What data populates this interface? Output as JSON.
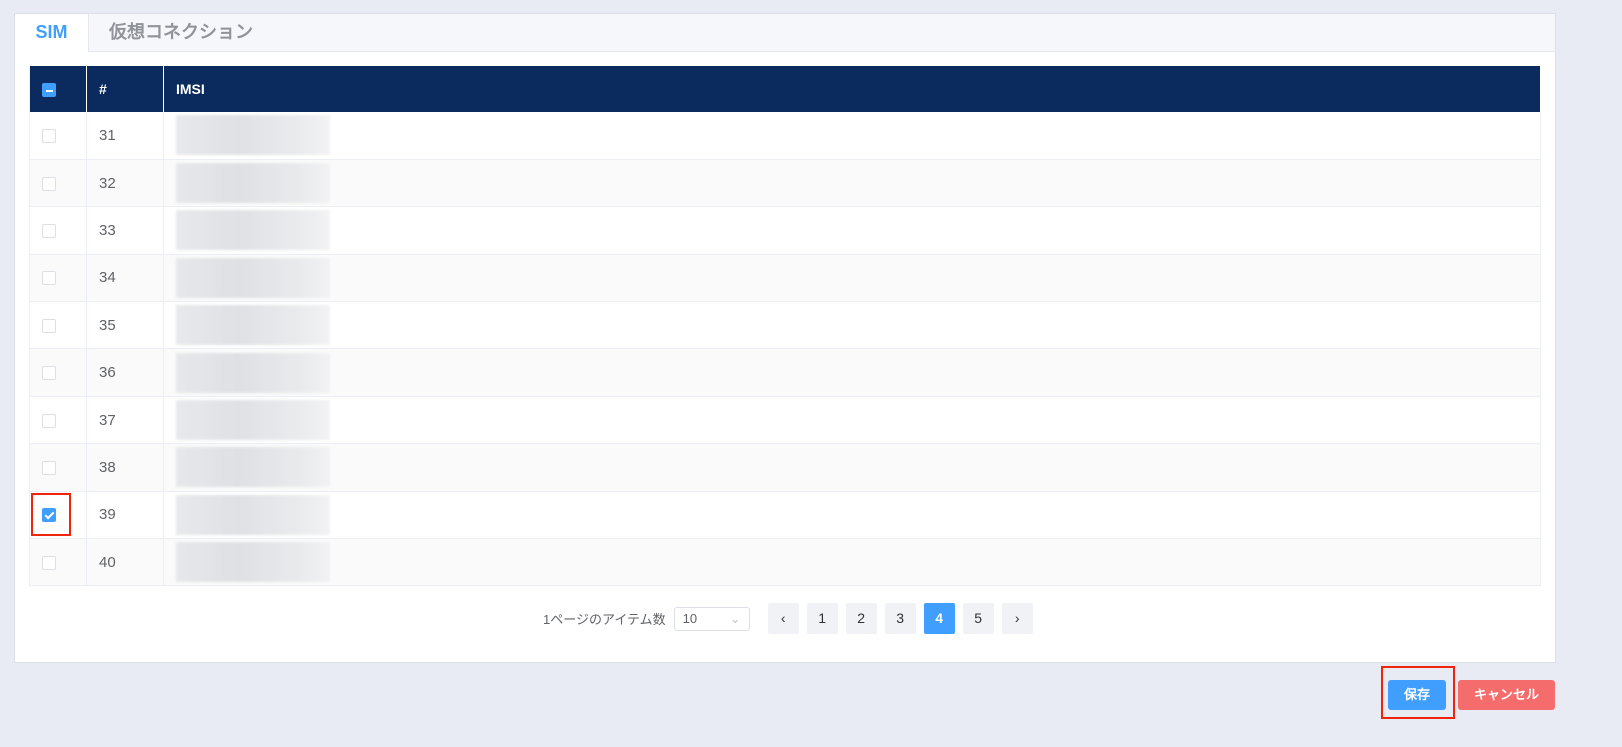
{
  "tabs": [
    {
      "label": "SIM",
      "active": true
    },
    {
      "label": "仮想コネクション",
      "active": false
    }
  ],
  "table": {
    "headers": [
      "#",
      "IMSI"
    ],
    "rows": [
      {
        "n": "31",
        "checked": false
      },
      {
        "n": "32",
        "checked": false
      },
      {
        "n": "33",
        "checked": false
      },
      {
        "n": "34",
        "checked": false
      },
      {
        "n": "35",
        "checked": false
      },
      {
        "n": "36",
        "checked": false
      },
      {
        "n": "37",
        "checked": false
      },
      {
        "n": "38",
        "checked": false
      },
      {
        "n": "39",
        "checked": true
      },
      {
        "n": "40",
        "checked": false
      }
    ]
  },
  "pagination": {
    "page_size_label": "1ページのアイテム数",
    "page_size": "10",
    "prev": "‹",
    "next": "›",
    "pages": [
      "1",
      "2",
      "3",
      "4",
      "5"
    ],
    "current": "4"
  },
  "actions": {
    "save": "保存",
    "cancel": "キャンセル"
  },
  "colors": {
    "accent": "#409eff",
    "header": "#0b2a5e",
    "cancel": "#f56c6c",
    "highlight": "#f0230b"
  }
}
